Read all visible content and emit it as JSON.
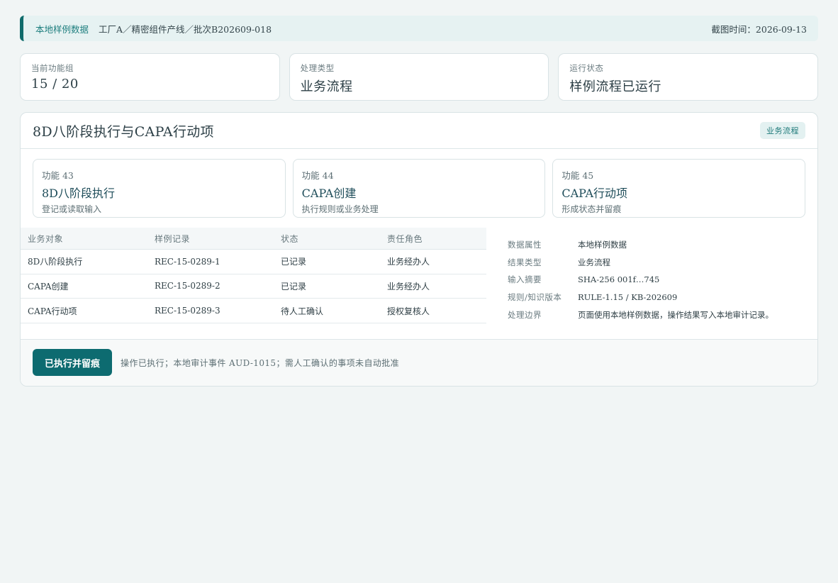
{
  "topbar": {
    "source": "本地样例数据",
    "path": "工厂A／精密组件产线／批次B202609-018",
    "time": "截图时间：2026-09-13"
  },
  "stats": [
    {
      "label": "当前功能组",
      "value": "15 / 20"
    },
    {
      "label": "处理类型",
      "value": "业务流程"
    },
    {
      "label": "运行状态",
      "value": "样例流程已运行"
    }
  ],
  "panel": {
    "title": "8D八阶段执行与CAPA行动项",
    "tag": "业务流程"
  },
  "functions": [
    {
      "num": "功能 43",
      "name": "8D八阶段执行",
      "desc": "登记或读取输入"
    },
    {
      "num": "功能 44",
      "name": "CAPA创建",
      "desc": "执行规则或业务处理"
    },
    {
      "num": "功能 45",
      "name": "CAPA行动项",
      "desc": "形成状态并留痕"
    }
  ],
  "table": {
    "headers": [
      "业务对象",
      "样例记录",
      "状态",
      "责任角色"
    ],
    "rows": [
      {
        "object": "8D八阶段执行",
        "record": "REC-15-0289-1",
        "status": "已记录",
        "role": "业务经办人"
      },
      {
        "object": "CAPA创建",
        "record": "REC-15-0289-2",
        "status": "已记录",
        "role": "业务经办人"
      },
      {
        "object": "CAPA行动项",
        "record": "REC-15-0289-3",
        "status": "待人工确认",
        "role": "授权复核人"
      }
    ]
  },
  "properties": [
    {
      "key": "数据属性",
      "value": "本地样例数据"
    },
    {
      "key": "结果类型",
      "value": "业务流程"
    },
    {
      "key": "输入摘要",
      "value": "SHA-256 001f…745"
    },
    {
      "key": "规则/知识版本",
      "value": "RULE-1.15 / KB-202609"
    },
    {
      "key": "处理边界",
      "value": "页面使用本地样例数据，操作结果写入本地审计记录。"
    }
  ],
  "footer": {
    "button": "已执行并留痕",
    "note": "操作已执行；本地审计事件 AUD-1015；需人工确认的事项未自动批准"
  },
  "colors": {
    "accent": "#0d6b70",
    "status_ok": "#2e7d5c",
    "status_pending": "#b07818"
  }
}
